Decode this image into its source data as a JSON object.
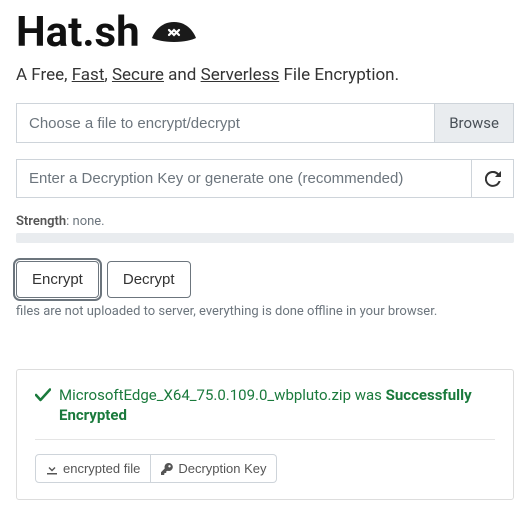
{
  "header": {
    "title": "Hat.sh"
  },
  "tagline": {
    "prefix": "A Free, ",
    "fast": "Fast",
    "sep1": ", ",
    "secure": "Secure",
    "sep2": " and ",
    "serverless": "Serverless",
    "suffix": " File Encryption."
  },
  "file_input": {
    "placeholder": "Choose a file to encrypt/decrypt",
    "browse_label": "Browse"
  },
  "key_input": {
    "placeholder": "Enter a Decryption Key or generate one (recommended)"
  },
  "strength": {
    "label": "Strength",
    "value": ": none."
  },
  "actions": {
    "encrypt": "Encrypt",
    "decrypt": "Decrypt"
  },
  "hint": "files are not uploaded to server, everything is done offline in your browser.",
  "result": {
    "filename": "MicrosoftEdge_X64_75.0.109.0_wbpluto.zip",
    "verb": " was ",
    "status": "Successfully Encrypted",
    "download_file": "encrypted file",
    "download_key": "Decryption Key"
  }
}
